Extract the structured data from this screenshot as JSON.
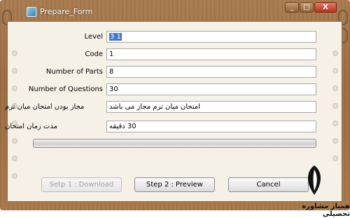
{
  "window": {
    "title": "Prepare_Form",
    "min_glyph": "_",
    "max_glyph": "□",
    "close_glyph": "X"
  },
  "form": {
    "level": {
      "label": "Level",
      "value": "3 1"
    },
    "code": {
      "label": "Code",
      "value": "1"
    },
    "parts": {
      "label": "Number of Parts",
      "value": "8"
    },
    "questions": {
      "label": "Number of Questions",
      "value": "30"
    },
    "midterm": {
      "label": "مجاز بودن امتحان میان ترم",
      "value": "امتحان میان ترم مجاز می باشد"
    },
    "duration": {
      "label": "مدت زمان امتحان",
      "value": "30 دقیقه"
    }
  },
  "progress": {
    "fraction": 0
  },
  "buttons": {
    "step1": "Setp 1 : Download",
    "step2": "Step 2 : Preview",
    "cancel": "Cancel"
  },
  "watermark": {
    "text": "همیار مشاوره تحصیلی"
  },
  "colors": {
    "frame": "#9b6c40",
    "paper": "#f6f1e7",
    "selection": "#3c78d0",
    "close": "#b63320"
  }
}
